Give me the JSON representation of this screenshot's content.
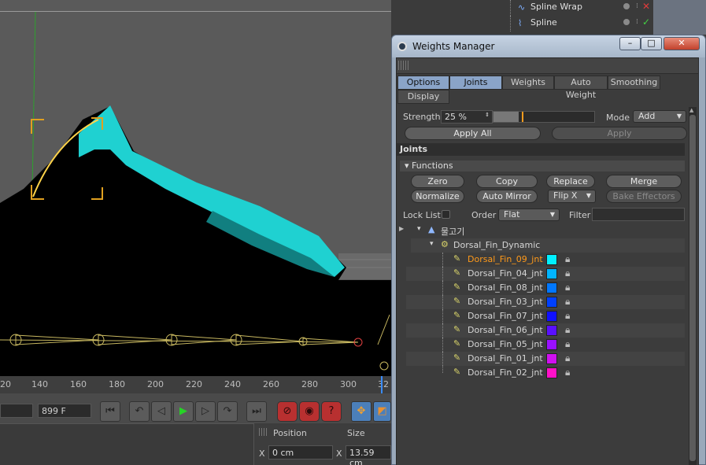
{
  "viewport": {
    "nav_icons": [
      "move-icon",
      "zoom-icon",
      "rotate-icon",
      "maximize-icon"
    ]
  },
  "object_manager": {
    "items": [
      {
        "label": "Spline Wrap",
        "status": "✕",
        "status_color": "#e03b3b"
      },
      {
        "label": "Spline",
        "status": "✓",
        "status_color": "#43d143"
      }
    ]
  },
  "timeline": {
    "ticks": [
      "20",
      "140",
      "160",
      "180",
      "200",
      "220",
      "240",
      "260",
      "280",
      "300",
      "32"
    ]
  },
  "transport": {
    "frame_field": "899 F"
  },
  "coordinates": {
    "position_header": "Position",
    "size_header": "Size",
    "x_label": "X",
    "position_x": "0 cm",
    "size_x_label": "X",
    "size_x": "13.59 cm"
  },
  "weights_manager": {
    "title": "Weights Manager",
    "window_buttons": {
      "minimize": "–",
      "maximize": "□",
      "close": "✕"
    },
    "tabs": [
      {
        "label": "Options",
        "active": true
      },
      {
        "label": "Joints",
        "active": true
      },
      {
        "label": "Weights",
        "active": false
      },
      {
        "label": "Auto Weight",
        "active": false
      },
      {
        "label": "Smoothing",
        "active": false
      },
      {
        "label": "Display",
        "active": false
      }
    ],
    "strength_label": "Strength",
    "strength_value": "25 %",
    "strength_fraction": 0.25,
    "mode_label": "Mode",
    "mode_value": "Add",
    "apply_all": "Apply All",
    "apply": "Apply",
    "joints_header": "Joints",
    "functions_header": "Functions",
    "functions": {
      "zero": "Zero",
      "copy": "Copy",
      "replace": "Replace",
      "merge": "Merge",
      "normalize": "Normalize",
      "auto_mirror": "Auto Mirror",
      "flip": "Flip X",
      "bake": "Bake Effectors"
    },
    "lock_list_label": "Lock List",
    "order_label": "Order",
    "order_value": "Flat",
    "filter_label": "Filter",
    "filter_value": "",
    "tree": {
      "root": "물고기",
      "group": "Dorsal_Fin_Dynamic",
      "joints": [
        {
          "name": "Dorsal_Fin_09_jnt",
          "color": "#00f0ff",
          "selected": true
        },
        {
          "name": "Dorsal_Fin_04_jnt",
          "color": "#00b4ff",
          "selected": false
        },
        {
          "name": "Dorsal_Fin_08_jnt",
          "color": "#0077ff",
          "selected": false
        },
        {
          "name": "Dorsal_Fin_03_jnt",
          "color": "#0040ff",
          "selected": false
        },
        {
          "name": "Dorsal_Fin_07_jnt",
          "color": "#1010ff",
          "selected": false
        },
        {
          "name": "Dorsal_Fin_06_jnt",
          "color": "#5a10ff",
          "selected": false
        },
        {
          "name": "Dorsal_Fin_05_jnt",
          "color": "#9a10ff",
          "selected": false
        },
        {
          "name": "Dorsal_Fin_01_jnt",
          "color": "#d010f0",
          "selected": false
        },
        {
          "name": "Dorsal_Fin_02_jnt",
          "color": "#ff10c8",
          "selected": false
        }
      ]
    }
  }
}
